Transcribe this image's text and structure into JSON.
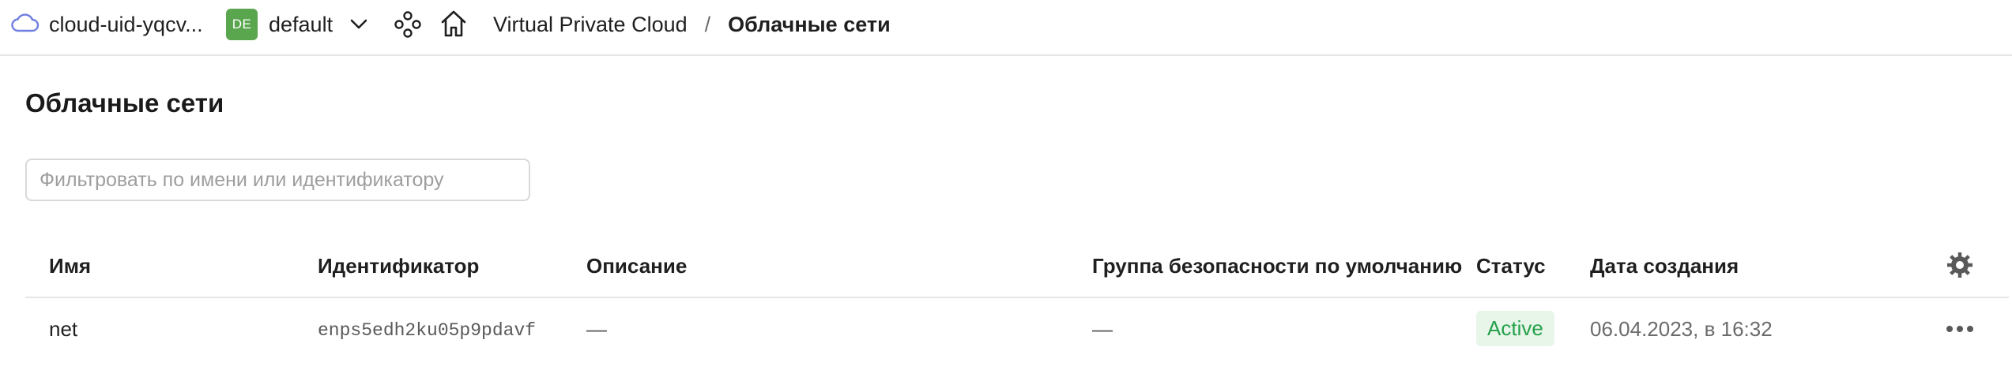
{
  "topbar": {
    "cloud_label": "cloud-uid-yqcv...",
    "folder": {
      "avatar": "DE",
      "name": "default",
      "avatar_color": "#5aa64e"
    },
    "breadcrumb": {
      "service": "Virtual Private Cloud",
      "separator": "/",
      "current": "Облачные сети"
    },
    "icons": [
      "cloud-icon",
      "chevron-down-icon",
      "services-icon",
      "home-icon"
    ]
  },
  "page": {
    "title": "Облачные сети",
    "filter": {
      "placeholder": "Фильтровать по имени или идентификатору",
      "value": ""
    }
  },
  "table": {
    "columns": [
      "Имя",
      "Идентификатор",
      "Описание",
      "Группа безопасности по умолчанию",
      "Статус",
      "Дата создания"
    ],
    "rows": [
      {
        "name": "net",
        "id": "enps5edh2ku05p9pdavf",
        "description": "—",
        "security_group": "—",
        "status": "Active",
        "created": "06.04.2023, в 16:32"
      }
    ],
    "settings_icon": "gear-icon",
    "row_menu_icon": "more-icon"
  },
  "colors": {
    "status_active_bg": "#e7f6e9",
    "status_active_text": "#26a14b",
    "divider": "#e5e5e5"
  }
}
